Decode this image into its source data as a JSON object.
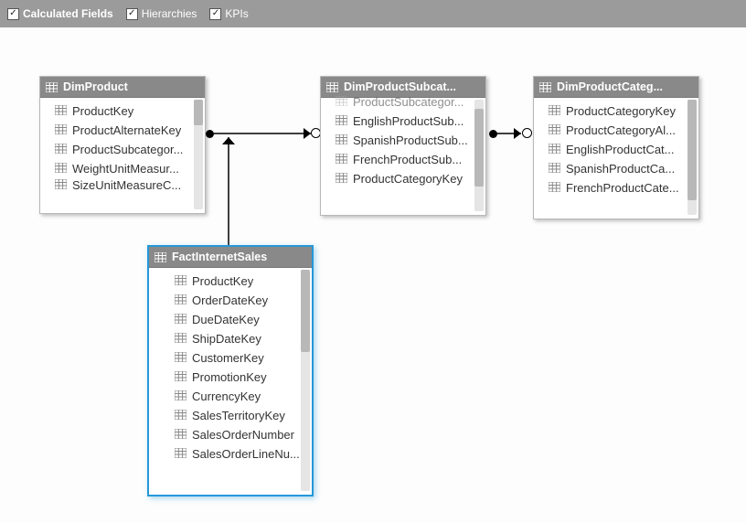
{
  "toolbar": {
    "items": [
      {
        "label": "Calculated Fields",
        "checked": true,
        "bold": true
      },
      {
        "label": "Hierarchies",
        "checked": true,
        "bold": false
      },
      {
        "label": "KPIs",
        "checked": true,
        "bold": false
      }
    ]
  },
  "tables": {
    "dimProduct": {
      "title": "DimProduct",
      "fields": [
        "ProductKey",
        "ProductAlternateKey",
        "ProductSubcategor...",
        "WeightUnitMeasur...",
        "SizeUnitMeasureC..."
      ]
    },
    "dimProductSubcat": {
      "title": "DimProductSubcat...",
      "fields": [
        "ProductSubcategor...",
        "EnglishProductSub...",
        "SpanishProductSub...",
        "FrenchProductSub...",
        "ProductCategoryKey"
      ]
    },
    "dimProductCateg": {
      "title": "DimProductCateg...",
      "fields": [
        "ProductCategoryKey",
        "ProductCategoryAl...",
        "EnglishProductCat...",
        "SpanishProductCa...",
        "FrenchProductCate..."
      ]
    },
    "factInternetSales": {
      "title": "FactInternetSales",
      "fields": [
        "ProductKey",
        "OrderDateKey",
        "DueDateKey",
        "ShipDateKey",
        "CustomerKey",
        "PromotionKey",
        "CurrencyKey",
        "SalesTerritoryKey",
        "SalesOrderNumber",
        "SalesOrderLineNu..."
      ]
    }
  }
}
